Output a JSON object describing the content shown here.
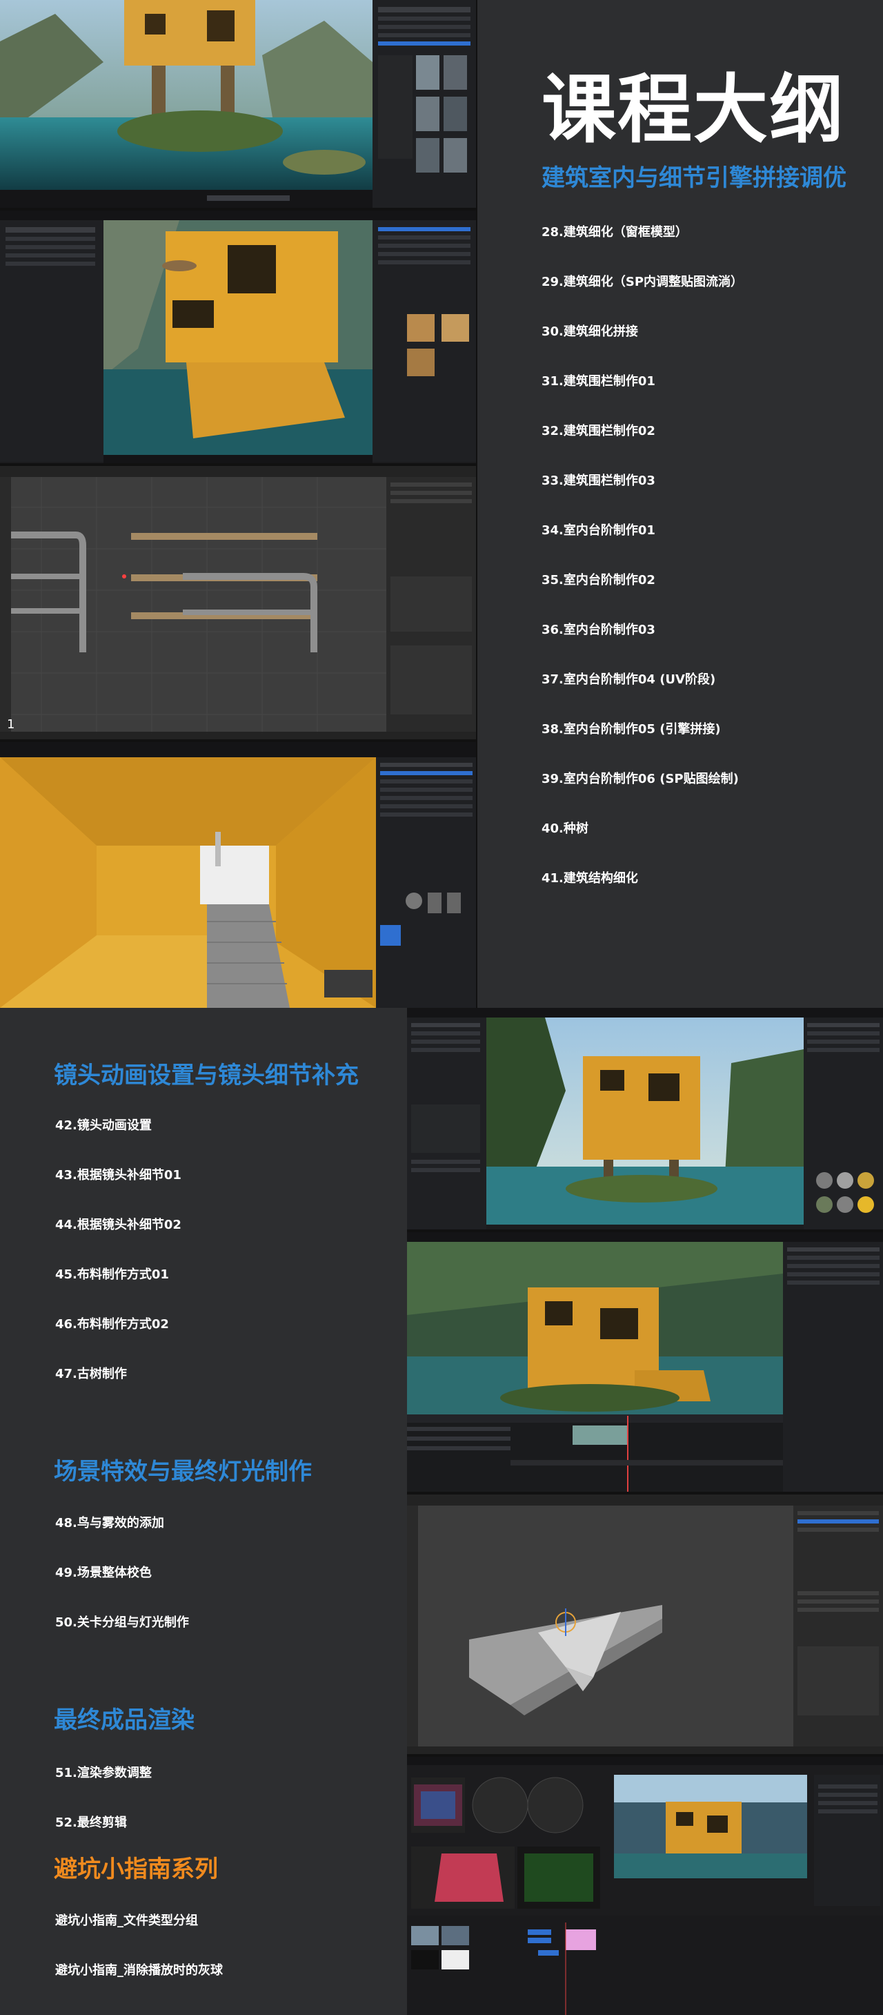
{
  "title": "课程大纲",
  "sections": [
    {
      "heading": "建筑室内与细节引擎拼接调优",
      "lessons": [
        "28.建筑细化（窗框模型）",
        "29.建筑细化（SP内调整贴图流淌）",
        "30.建筑细化拼接",
        "31.建筑围栏制作01",
        "32.建筑围栏制作02",
        "33.建筑围栏制作03",
        "34.室内台阶制作01",
        "35.室内台阶制作02",
        "36.室内台阶制作03",
        "37.室内台阶制作04 (UV阶段)",
        "38.室内台阶制作05 (引擎拼接)",
        "39.室内台阶制作06 (SP贴图绘制)",
        "40.种树",
        "41.建筑结构细化"
      ]
    },
    {
      "heading": "镜头动画设置与镜头细节补充",
      "lessons": [
        "42.镜头动画设置",
        "43.根据镜头补细节01",
        "44.根据镜头补细节02",
        "45.布料制作方式01",
        "46.布料制作方式02",
        "47.古树制作"
      ]
    },
    {
      "heading": "场景特效与最终灯光制作",
      "lessons": [
        "48.鸟与雾效的添加",
        "49.场景整体校色",
        "50.关卡分组与灯光制作"
      ]
    },
    {
      "heading": "最终成品渲染",
      "lessons": [
        "51.渲染参数调整",
        "52.最终剪辑"
      ]
    },
    {
      "heading": "避坑小指南系列",
      "lessons": [
        "避坑小指南_文件类型分组",
        "避坑小指南_消除播放时的灰球"
      ]
    }
  ],
  "viewport_label": "1",
  "colors": {
    "heading_blue": "#2e88d6",
    "heading_orange": "#f08a1e",
    "background": "#2d2e30"
  }
}
